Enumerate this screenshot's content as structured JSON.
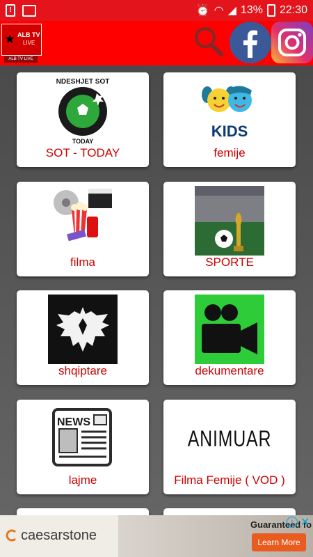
{
  "status": {
    "battery": "13%",
    "time": "22:30"
  },
  "header": {
    "logo_line1": "ALB TV",
    "logo_line2": "LIVE",
    "logo_sub": "ALB TV LIVE"
  },
  "cards": [
    {
      "label": "SOT - TODAY",
      "art_top": "NDESHJET SOT",
      "art_bottom": "TODAY"
    },
    {
      "label": "femije",
      "art_text": "KIDS"
    },
    {
      "label": "filma"
    },
    {
      "label": "SPORTE"
    },
    {
      "label": "shqiptare"
    },
    {
      "label": "dekumentare"
    },
    {
      "label": "lajme",
      "art_text": "NEWS"
    },
    {
      "label": "Filma Femije ( VOD )",
      "art_text": "ANIMUAR"
    }
  ],
  "ad": {
    "brand": "caesarstone",
    "headline": "Guaranteed fo",
    "cta": "Learn More"
  },
  "colors": {
    "primary": "#ff0000",
    "label": "#cc0000"
  }
}
